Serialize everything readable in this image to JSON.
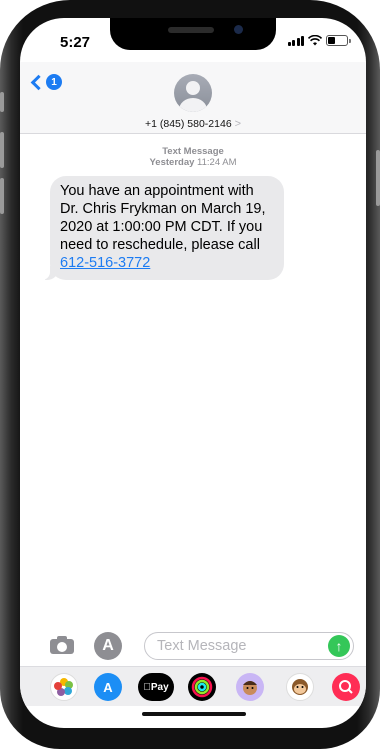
{
  "status_bar": {
    "time": "5:27"
  },
  "header": {
    "back_badge": "1",
    "contact": "+1 (845) 580-2146",
    "contact_chevron": ">"
  },
  "thread": {
    "meta_label": "Text Message",
    "meta_day": "Yesterday",
    "meta_time": "11:24 AM",
    "message_text": "You have an appointment with Dr. Chris Frykman on March 19, 2020 at 1:00:00 PM CDT. If you need to reschedule, please call",
    "message_link": "612-516-3772"
  },
  "composer": {
    "placeholder": "Text Message",
    "appstore_glyph": "A",
    "send_glyph": "↑"
  },
  "app_drawer": {
    "apple_pay_label": "Pay",
    "apps": [
      "photos-app",
      "app-store-app",
      "apple-pay-app",
      "activity-app",
      "memoji-app",
      "animoji-app",
      "web-search-app"
    ]
  },
  "colors": {
    "accent_blue": "#1d7cf2",
    "bubble_gray": "#e9e9eb",
    "send_green": "#34c759"
  }
}
